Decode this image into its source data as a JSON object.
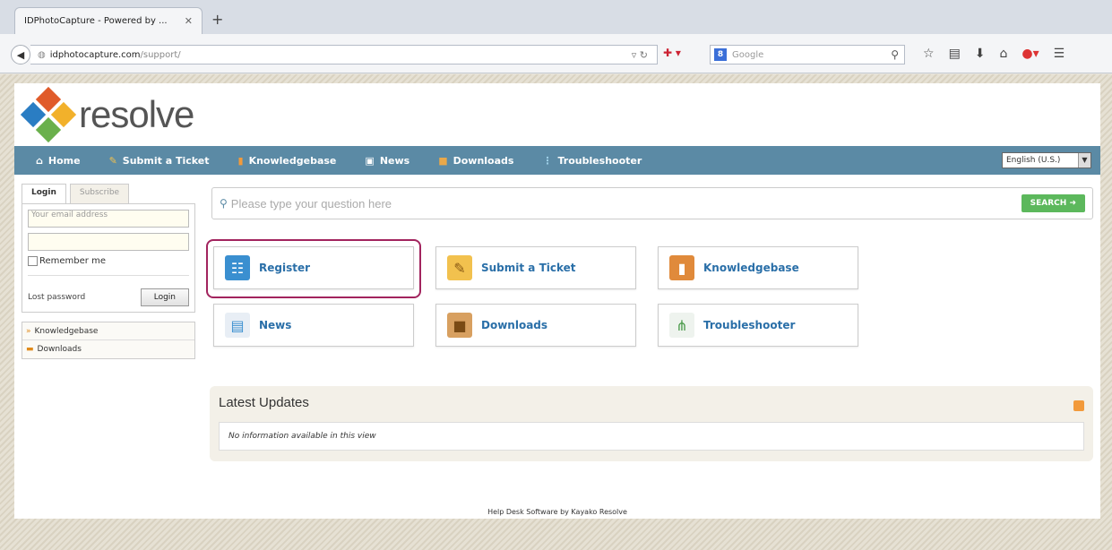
{
  "browser": {
    "tab_title": "IDPhotoCapture - Powered by ...",
    "new_tab": "+",
    "url_host": "idphotocapture.com",
    "url_path": "/support/",
    "search_placeholder": "Google"
  },
  "logo": {
    "text": "resolve"
  },
  "nav": {
    "items": [
      {
        "label": "Home",
        "icon": "home-icon"
      },
      {
        "label": "Submit a Ticket",
        "icon": "pencil-icon"
      },
      {
        "label": "Knowledgebase",
        "icon": "book-icon"
      },
      {
        "label": "News",
        "icon": "news-icon"
      },
      {
        "label": "Downloads",
        "icon": "box-icon"
      },
      {
        "label": "Troubleshooter",
        "icon": "network-icon"
      }
    ],
    "language": "English (U.S.)"
  },
  "sidebar": {
    "tabs": [
      "Login",
      "Subscribe"
    ],
    "email_placeholder": "Your email address",
    "remember_label": "Remember me",
    "lost_password": "Lost password",
    "login_button": "Login",
    "links": [
      "Knowledgebase",
      "Downloads"
    ]
  },
  "search": {
    "placeholder": "Please type your question here",
    "button": "SEARCH"
  },
  "tiles": [
    "Register",
    "Submit a Ticket",
    "Knowledgebase",
    "News",
    "Downloads",
    "Troubleshooter"
  ],
  "updates": {
    "title": "Latest Updates",
    "empty": "No information available in this view"
  },
  "footer": "Help Desk Software by Kayako Resolve",
  "colors": {
    "nav_bg": "#5b8aa5",
    "highlight": "#a2245e",
    "search_btn": "#5cb85c"
  }
}
